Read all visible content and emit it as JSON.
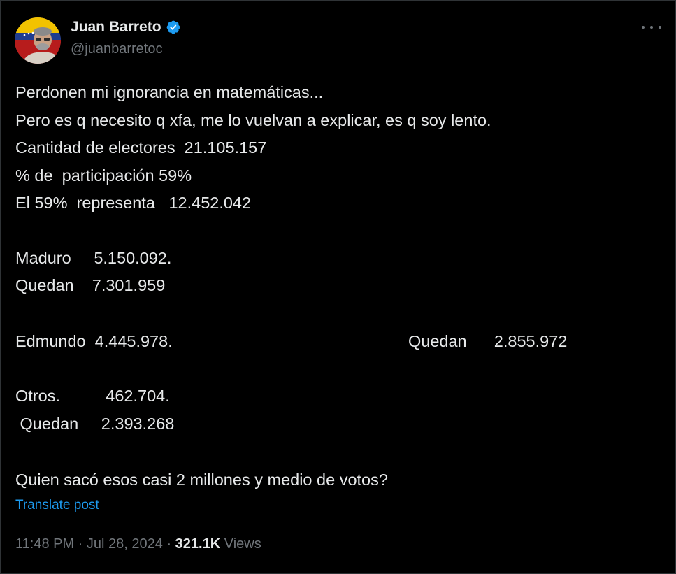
{
  "author": {
    "display_name": "Juan Barreto",
    "handle": "@juanbarretoc",
    "verified_icon": "verified-badge-icon",
    "verified_color": "#1d9bf0"
  },
  "post": {
    "lines": [
      "Perdonen mi ignorancia en matemáticas...",
      "Pero es q necesito q xfa, me lo vuelvan a explicar, es q soy lento.",
      "Cantidad de electores  21.105.157",
      "% de  participación 59%",
      "El 59%  representa   12.452.042",
      "Maduro     5.150.092.",
      "Quedan    7.301.959",
      "Edmundo  4.445.978.",
      "Quedan      2.855.972",
      "Otros.          462.704.",
      " Quedan     2.393.268",
      "Quien sacó esos casi 2 millones y medio de votos?"
    ],
    "translate_label": "Translate post"
  },
  "meta": {
    "time": "11:48 PM",
    "separator": " · ",
    "date": "Jul 28, 2024",
    "views_count": "321.1K",
    "views_label": " Views"
  },
  "colors": {
    "background": "#000000",
    "text": "#e7e9ea",
    "secondary": "#71767b",
    "link": "#1d9bf0"
  }
}
